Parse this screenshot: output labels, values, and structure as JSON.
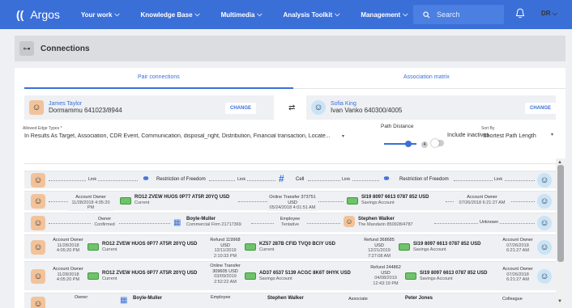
{
  "nav": {
    "logo": "((",
    "brand": "Argos",
    "items": [
      "Your work",
      "Knowledge Base",
      "Multimedia",
      "Analysis Toolkit",
      "Management"
    ],
    "chevron": "⌵",
    "search_placeholder": "Search",
    "user": "DR",
    "bell": "🔔",
    "search_icon": "magnifier-icon"
  },
  "page": {
    "title": "Connections",
    "icon": "connections-icon"
  },
  "tabs": [
    "Pair connections",
    "Association matrix"
  ],
  "left": {
    "name": "James Taylor",
    "number": "Dormammu 641023/8944",
    "change": "CHANGE"
  },
  "right": {
    "name": "Sofia King",
    "number": "Ivan Vanko 640300/4005",
    "change": "CHANGE"
  },
  "swap_icon": "⇄",
  "controls": {
    "edge_label": "Allowed Edge Types *",
    "edge_value": "In Results As Target, Association, CDR Event, Communication, disposal_right, Distribution, Financial transaction, Locate...",
    "path_label": "Path Distance",
    "path_value": "4",
    "inactives": "Include inactives",
    "sort_label": "Sort By",
    "sort_value": "Shortest Path Length",
    "caret": "▾"
  },
  "rows": [
    {
      "link1": "Link",
      "mid1": "Restriction of Freedom",
      "link2": "Link",
      "mid2": "Cell",
      "link3": "Link",
      "mid3": "Restriction of Freedom",
      "link4": "Link"
    },
    {
      "e1": "Account Owner",
      "d1": "11/28/2018 4:05:20 PM",
      "acc1": "RO12 ZVEW HUOS 0P77 AT5R 20YQ USD",
      "acc1s": "Current",
      "e2": "Online Transfer 373751 USD",
      "d2": "05/24/2018 4:01:51 AM",
      "acc2": "SI19 8097 6613 0787 852 USD",
      "acc2s": "Savings Account",
      "e3": "Account Owner",
      "d3": "07/26/2018 6:21:27 AM"
    },
    {
      "e1": "Owner",
      "d1": "Confirmed",
      "org": "Boyle-Muller",
      "orgs": "Commercial Firm 21717369",
      "e2": "Employee",
      "d2": "Tentative",
      "per": "Stephen Walker",
      "pers": "The Mandarin 850928/4787",
      "e3": "Unknown"
    },
    {
      "e1": "Account Owner",
      "d1": "11/28/2018 4:05:20 PM",
      "acc1": "RO12 ZVEW HUOS 0P77 AT5R 20YQ USD",
      "acc1s": "Current",
      "e2": "Refund 119968 USD",
      "d2": "12/11/2019 2:10:33 PM",
      "acc2": "KZ57 287B CFID TVQ0 BCIY USD",
      "acc2s": "Current",
      "e3": "Refund 368685 USD",
      "d3": "12/21/2019 7:27:08 AM",
      "acc3": "SI19 8097 6613 0787 852 USD",
      "acc3s": "Savings Account",
      "e4": "Account Owner",
      "d4": "07/26/2018 6:21:27 AM"
    },
    {
      "e1": "Account Owner",
      "d1": "11/28/2018 4:05:20 PM",
      "acc1": "RO12 ZVEW HUOS 0P77 AT5R 20YQ USD",
      "acc1s": "Current",
      "e2": "Online Transfer 309605 USD",
      "d2": "03/09/2019 2:52:22 AM",
      "acc2": "AD37 6537 5139 ACGC 8K6T 0HYK USD",
      "acc2s": "Savings Account",
      "e3": "Refund 244862 USD",
      "d3": "04/08/2019 12:43:19 PM",
      "acc3": "SI19 8097 6613 0787 852 USD",
      "acc3s": "Savings Account",
      "e4": "Account Owner",
      "d4": "07/26/2018 6:21:27 AM"
    },
    {
      "e1": "Owner",
      "org": "Boyle-Muller",
      "e2": "Employee",
      "per": "Stephen Walker",
      "e3": "Associate",
      "per2": "Peter Jones",
      "e4": "Colleague"
    }
  ]
}
